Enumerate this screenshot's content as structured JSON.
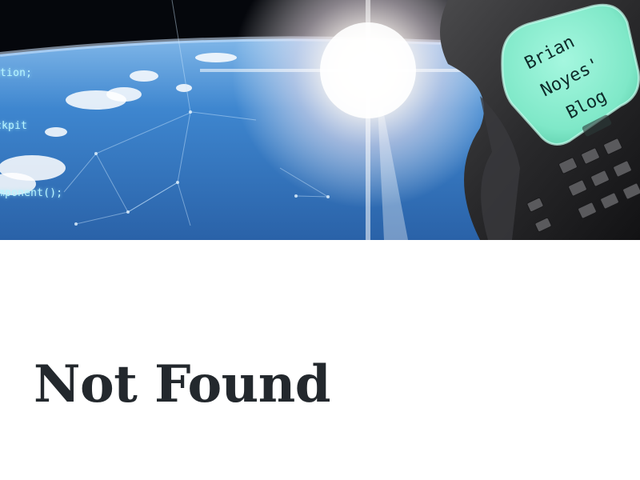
{
  "header": {
    "blog_title_lines": [
      "Brian",
      "Noyes'",
      "Blog"
    ],
    "code_snippets": [
      "ation;",
      "ckpit",
      "omponent();"
    ]
  },
  "main": {
    "title": "Not Found"
  },
  "colors": {
    "title_text": "#23282d",
    "screen_glow": "#8ff2d4",
    "code_text": "#b9f6ff",
    "space": "#000000",
    "earth": "#3f7fc4"
  }
}
